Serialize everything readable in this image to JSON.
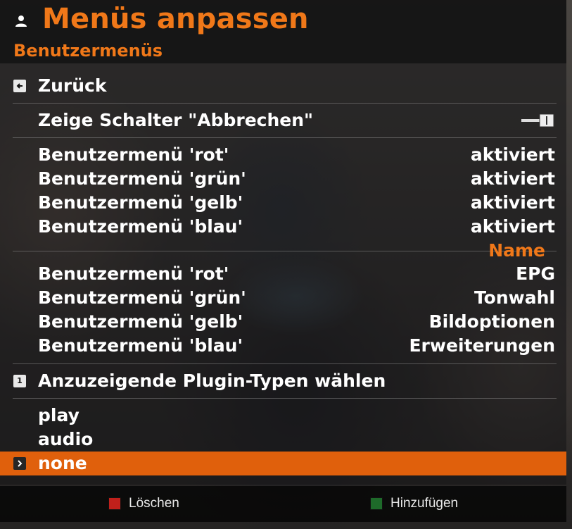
{
  "header": {
    "title": "Menüs anpassen",
    "subtitle": "Benutzermenüs",
    "icon": "user-icon"
  },
  "menu": {
    "back_label": "Zurück",
    "cancel_toggle_label": "Zeige Schalter \"Abbrechen\"",
    "status_rows": [
      {
        "label": "Benutzermenü 'rot'",
        "value": "aktiviert"
      },
      {
        "label": "Benutzermenü 'grün'",
        "value": "aktiviert"
      },
      {
        "label": "Benutzermenü 'gelb'",
        "value": "aktiviert"
      },
      {
        "label": "Benutzermenü 'blau'",
        "value": "aktiviert"
      }
    ],
    "name_section_header": "Name",
    "name_rows": [
      {
        "label": "Benutzermenü 'rot'",
        "value": "EPG"
      },
      {
        "label": "Benutzermenü 'grün'",
        "value": "Tonwahl"
      },
      {
        "label": "Benutzermenü 'gelb'",
        "value": "Bildoptionen"
      },
      {
        "label": "Benutzermenü 'blau'",
        "value": "Erweiterungen"
      }
    ],
    "plugin_types_key": "1",
    "plugin_types_label": "Anzuzeigende Plugin-Typen wählen",
    "plugin_types": [
      "play",
      "audio",
      "none"
    ],
    "selected_plugin_type": "none"
  },
  "footer": {
    "delete_label": "Löschen",
    "add_label": "Hinzufügen"
  },
  "colors": {
    "accent": "#f07819",
    "selection": "#e0600c",
    "red_button": "#c0201b",
    "green_button": "#1e6a2a"
  }
}
